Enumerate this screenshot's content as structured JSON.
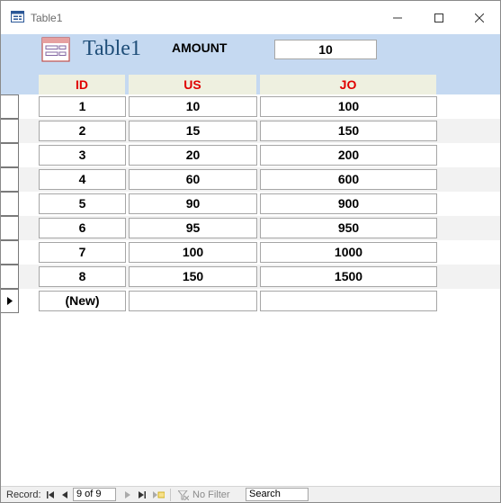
{
  "window": {
    "title": "Table1",
    "minimize_icon": "minimize-icon",
    "maximize_icon": "maximize-icon",
    "close_icon": "close-icon"
  },
  "form": {
    "title": "Table1",
    "amount_label": "AMOUNT",
    "amount_value": "10",
    "icon": "table-form-icon"
  },
  "columns": [
    "ID",
    "US",
    "JO"
  ],
  "rows": [
    {
      "id": "1",
      "us": "10",
      "jo": "100"
    },
    {
      "id": "2",
      "us": "15",
      "jo": "150"
    },
    {
      "id": "3",
      "us": "20",
      "jo": "200"
    },
    {
      "id": "4",
      "us": "60",
      "jo": "600"
    },
    {
      "id": "5",
      "us": "90",
      "jo": "900"
    },
    {
      "id": "6",
      "us": "95",
      "jo": "950"
    },
    {
      "id": "7",
      "us": "100",
      "jo": "1000"
    },
    {
      "id": "8",
      "us": "150",
      "jo": "1500"
    }
  ],
  "new_row": {
    "id": "(New)",
    "us": "",
    "jo": ""
  },
  "statusbar": {
    "record_label": "Record:",
    "record_position": "9 of 9",
    "filter_label": "No Filter",
    "search_label": "Search"
  },
  "colors": {
    "header_band": "#c5d9f1",
    "column_header_text": "#e00000",
    "column_header_bg": "#eef0e0",
    "alt_row": "#f2f2f2"
  }
}
